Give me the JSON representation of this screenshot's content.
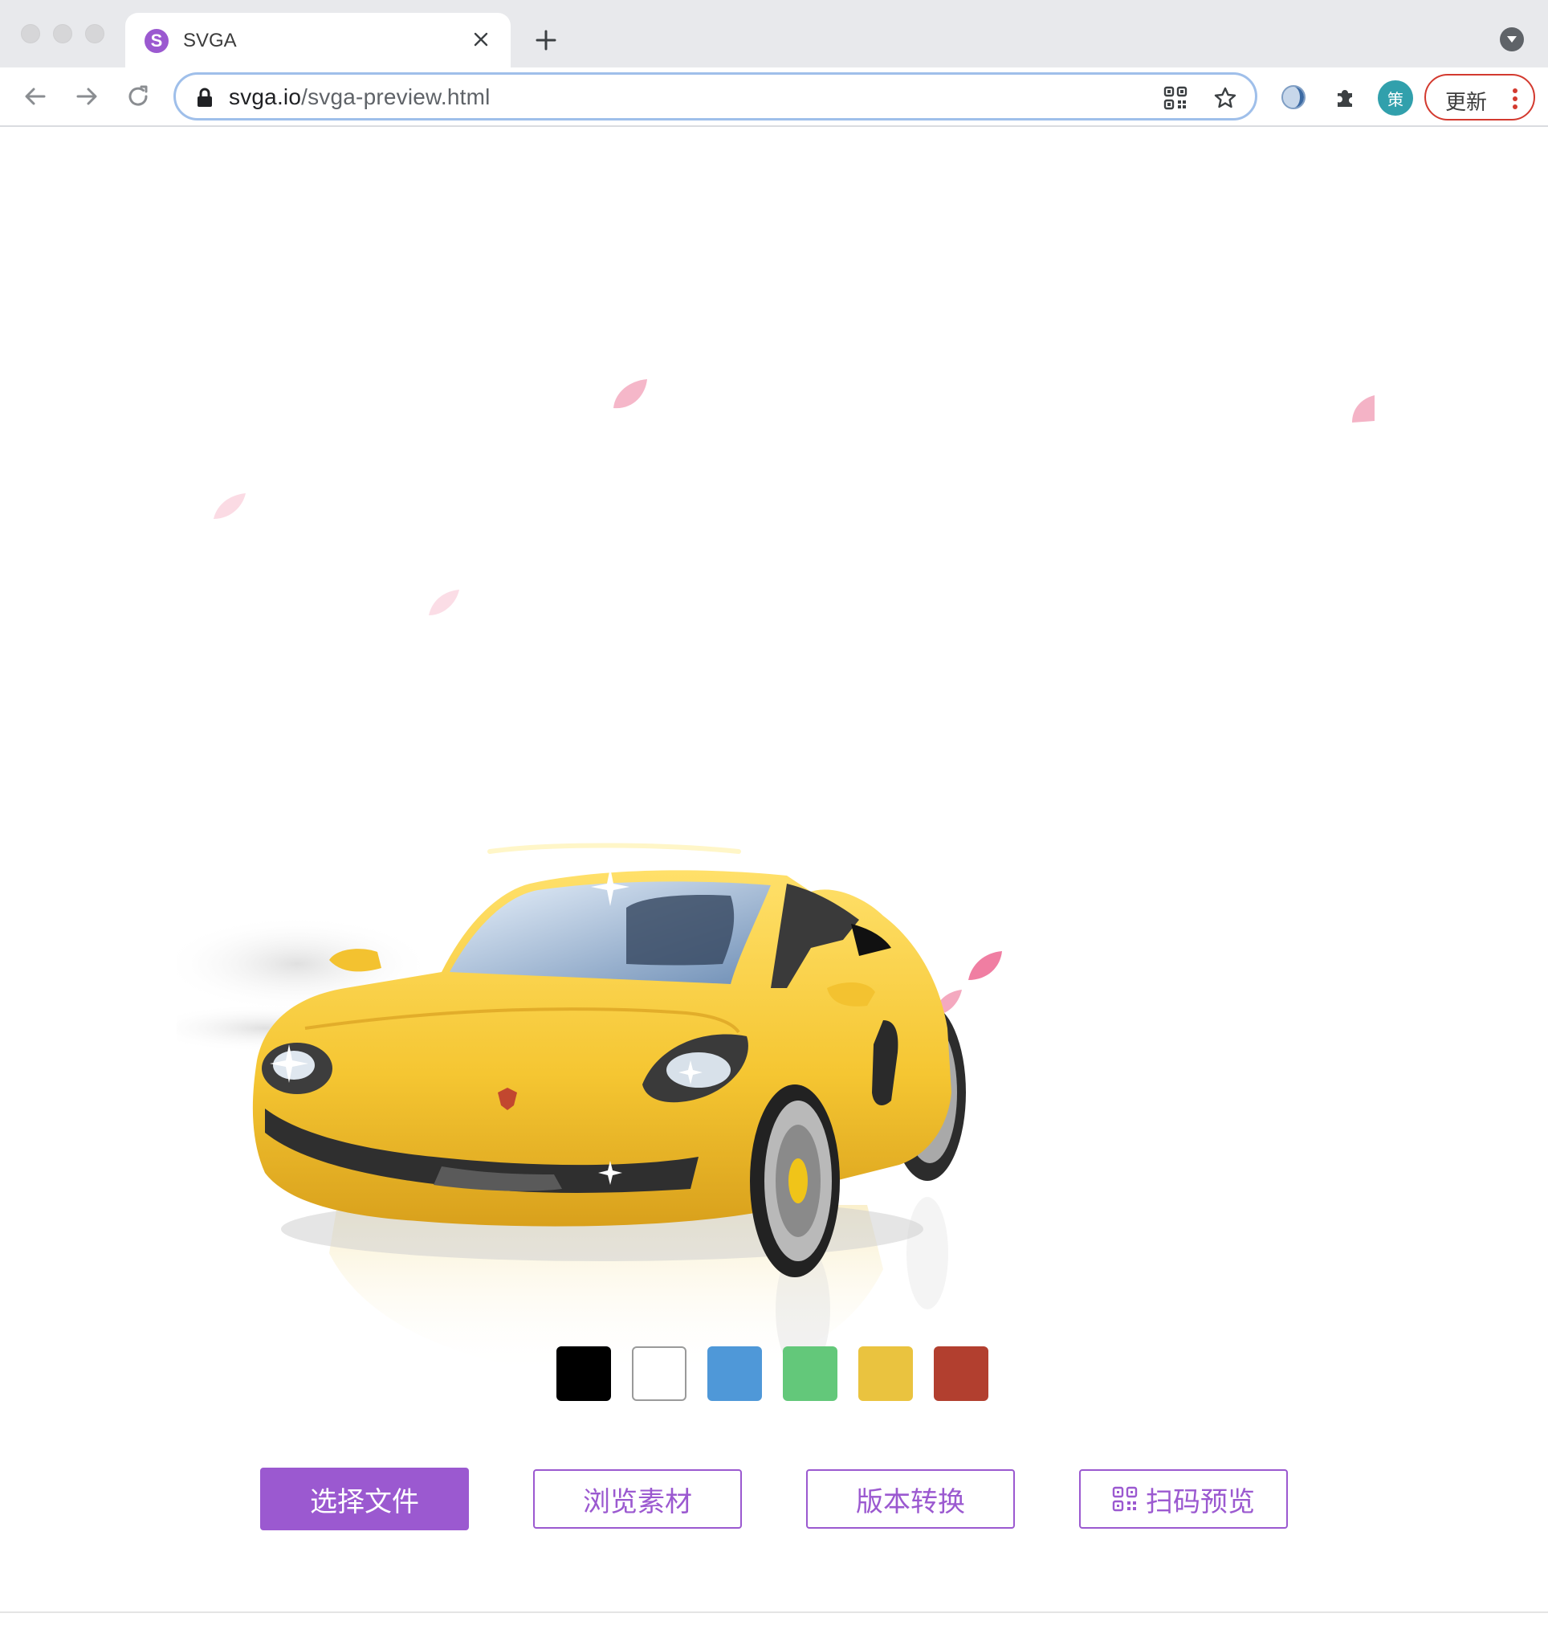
{
  "browser": {
    "tab": {
      "favicon_letter": "S",
      "title": "SVGA"
    },
    "address_bar": {
      "host": "svga.io",
      "path": "/svga-preview.html"
    },
    "profile_initial": "策",
    "update_label": "更新"
  },
  "preview": {
    "subject": "yellow convertible sports car with falling pink petals",
    "color_swatches": [
      {
        "name": "black",
        "color": "#000000"
      },
      {
        "name": "white",
        "color": "#ffffff"
      },
      {
        "name": "blue",
        "color": "#4f98d8"
      },
      {
        "name": "green",
        "color": "#63c87a"
      },
      {
        "name": "yellow",
        "color": "#eac33f"
      },
      {
        "name": "red",
        "color": "#b23f2f"
      }
    ]
  },
  "actions": {
    "select_file": "选择文件",
    "browse_assets": "浏览素材",
    "version_convert": "版本转换",
    "scan_preview": "扫码预览"
  },
  "theme": {
    "accent": "#9b59d0",
    "update_border": "#d33a2f"
  }
}
